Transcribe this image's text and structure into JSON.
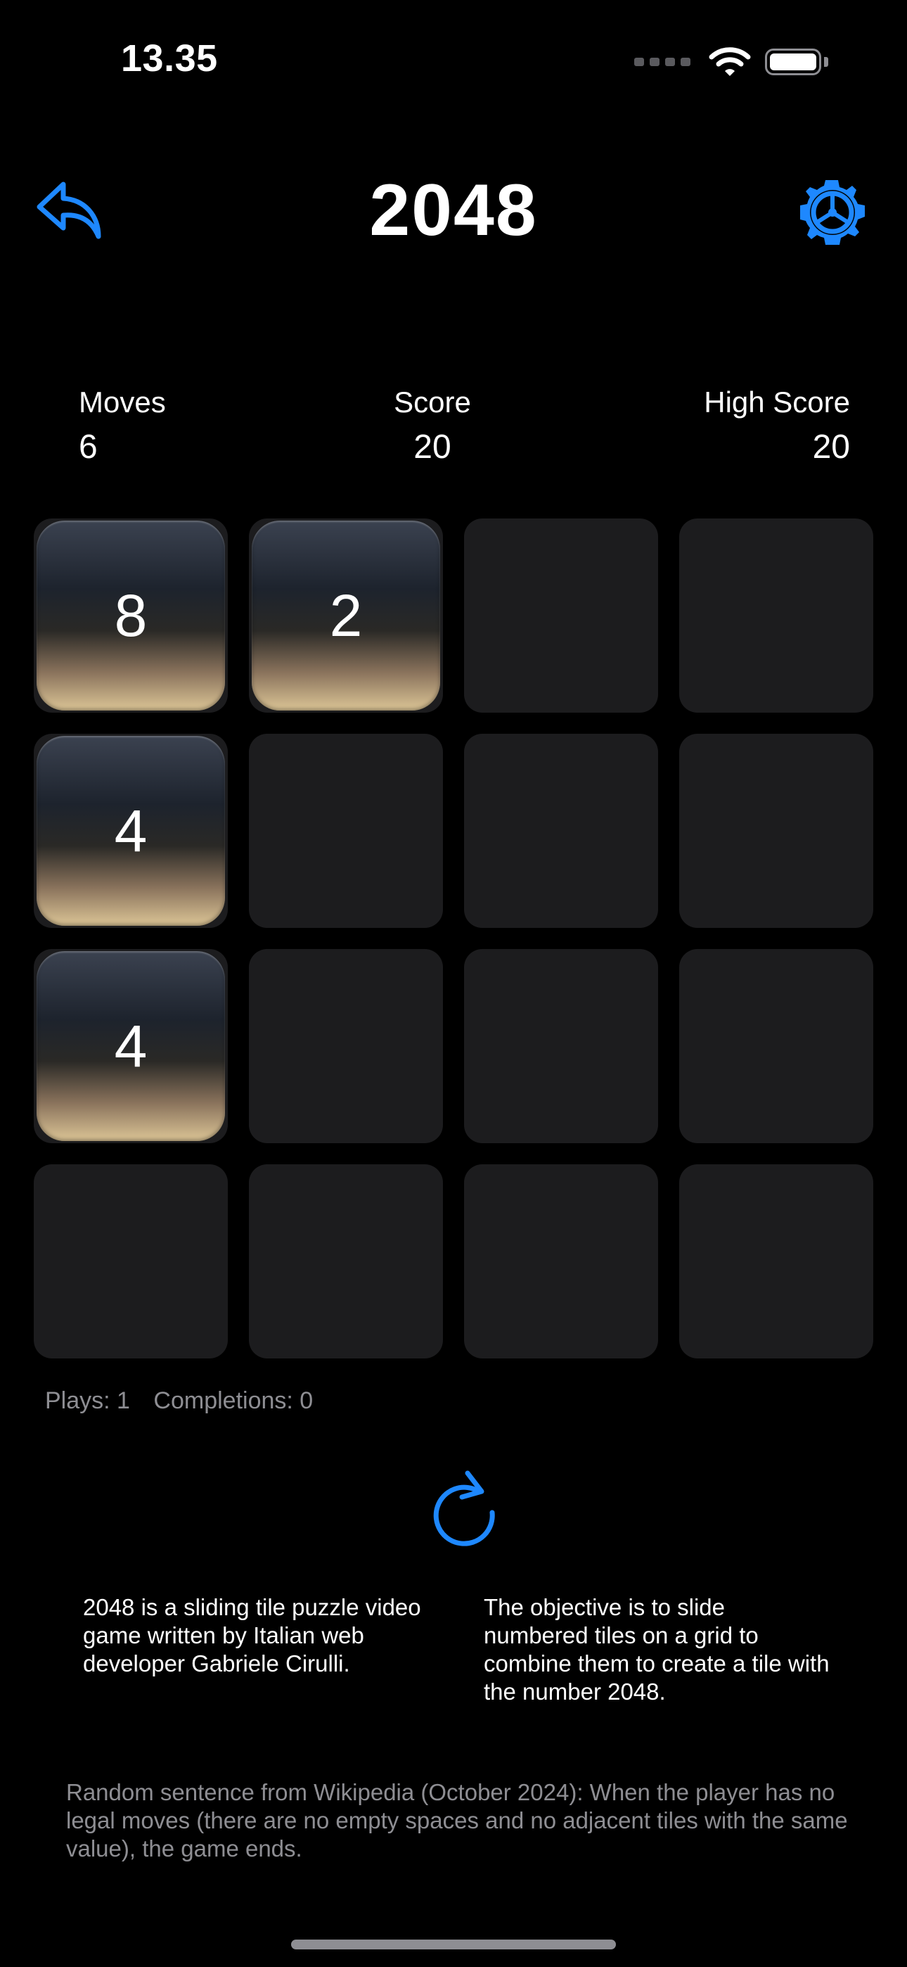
{
  "status_bar": {
    "time": "13.35"
  },
  "header": {
    "title": "2048",
    "back_icon": "arrow-uturn-left-icon",
    "settings_icon": "gear-icon"
  },
  "stats": {
    "moves": {
      "label": "Moves",
      "value": "6"
    },
    "score": {
      "label": "Score",
      "value": "20"
    },
    "high_score": {
      "label": "High Score",
      "value": "20"
    }
  },
  "board": {
    "rows": [
      [
        "8",
        "2",
        "",
        ""
      ],
      [
        "4",
        "",
        "",
        ""
      ],
      [
        "4",
        "",
        "",
        ""
      ],
      [
        "",
        "",
        "",
        ""
      ]
    ]
  },
  "footer": {
    "plays": "Plays: 1",
    "completions": "Completions: 0",
    "restart_icon": "arrow-clockwise-icon"
  },
  "description": {
    "left": "2048 is a sliding tile puzzle video game written by Italian web developer Gabriele Cirulli.",
    "right": "The objective is to slide numbered tiles on a grid to combine them to create a tile with the number 2048."
  },
  "wiki_sentence": "Random sentence from Wikipedia (October 2024): When the player has no legal moves (there are no empty spaces and no adjacent tiles with the same value), the game ends.",
  "colors": {
    "accent": "#1e88ff",
    "background": "#000000",
    "empty_cell": "#1c1c1e",
    "secondary_text": "#8e8e93"
  }
}
